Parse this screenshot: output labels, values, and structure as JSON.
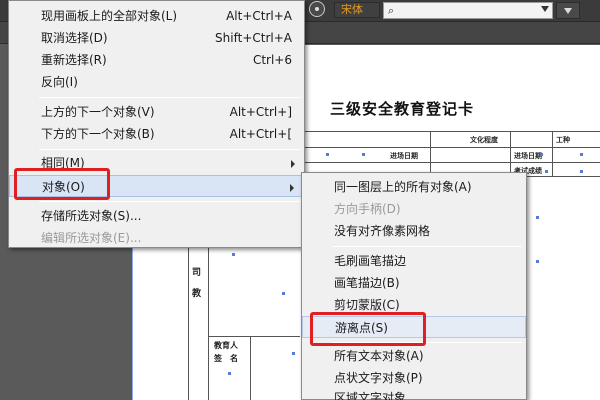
{
  "toolbar": {
    "font_label": "宋体",
    "font_search_value": "",
    "search_glyph": "⌕"
  },
  "document": {
    "title": "三级安全教育登记卡",
    "fields": {
      "education_level": "文化程度",
      "work_type": "工种",
      "entry_date": "进场日期",
      "entry_date_2": "进场日期",
      "exam_score": "考试成绩",
      "side_chars": [
        "司",
        "教"
      ],
      "educator": "教育人",
      "signature": "签　名"
    }
  },
  "menu": {
    "items": [
      {
        "label": "现用画板上的全部对象(L)",
        "shortcut": "Alt+Ctrl+A",
        "disabled": false
      },
      {
        "label": "取消选择(D)",
        "shortcut": "Shift+Ctrl+A",
        "disabled": false
      },
      {
        "label": "重新选择(R)",
        "shortcut": "Ctrl+6",
        "disabled": false
      },
      {
        "label": "反向(I)",
        "shortcut": "",
        "disabled": false
      },
      {
        "label": "上方的下一个对象(V)",
        "shortcut": "Alt+Ctrl+]",
        "disabled": false
      },
      {
        "label": "下方的下一个对象(B)",
        "shortcut": "Alt+Ctrl+[",
        "disabled": false
      },
      {
        "label": "相同(M)",
        "shortcut": "",
        "disabled": false,
        "submenu": true
      },
      {
        "label": "对象(O)",
        "shortcut": "",
        "disabled": false,
        "submenu": true
      },
      {
        "label": "存储所选对象(S)...",
        "shortcut": "",
        "disabled": false
      },
      {
        "label": "编辑所选对象(E)...",
        "shortcut": "",
        "disabled": true
      }
    ]
  },
  "submenu": {
    "items": [
      {
        "label": "同一图层上的所有对象(A)",
        "disabled": false
      },
      {
        "label": "方向手柄(D)",
        "disabled": true
      },
      {
        "label": "没有对齐像素网格",
        "disabled": false
      },
      {
        "label": "毛刷画笔描边",
        "disabled": false
      },
      {
        "label": "画笔描边(B)",
        "disabled": false
      },
      {
        "label": "剪切蒙版(C)",
        "disabled": false
      },
      {
        "label": "游离点(S)",
        "disabled": false
      },
      {
        "label": "所有文本对象(A)",
        "disabled": false
      },
      {
        "label": "点状文字对象(P)",
        "disabled": false
      },
      {
        "label": "区域文字对象",
        "disabled": false
      }
    ]
  },
  "highlight_color": "#e02020"
}
